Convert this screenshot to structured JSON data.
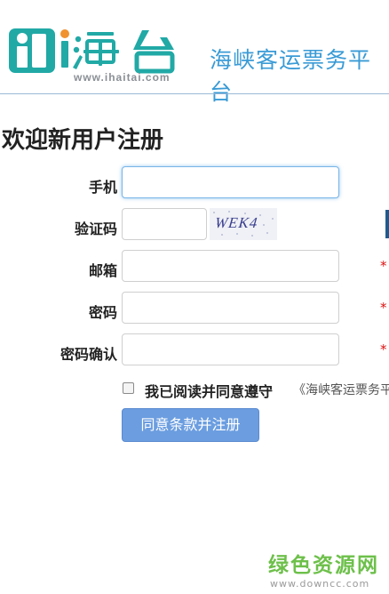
{
  "header": {
    "logo_text": "i海台",
    "logo_url": "www.ihaitai.com",
    "slogan": "海峡客运票务平台"
  },
  "page_title": "欢迎新用户注册",
  "form": {
    "phone": {
      "label": "手机",
      "value": "",
      "placeholder": ""
    },
    "verify": {
      "label": "验证码",
      "value": "",
      "placeholder": "",
      "captcha": "WEK4"
    },
    "email": {
      "label": "邮箱",
      "value": "",
      "placeholder": "",
      "required_mark": "*"
    },
    "password": {
      "label": "密码",
      "value": "",
      "placeholder": "",
      "required_mark": "*"
    },
    "password_confirm": {
      "label": "密码确认",
      "value": "",
      "placeholder": "",
      "required_mark": "*"
    },
    "agree": {
      "checked": false,
      "text": "我已阅读并同意遵守",
      "terms_link": "《海峡客运票务平"
    },
    "submit_label": "同意条款并注册"
  },
  "watermark": {
    "main": "绿色资源网",
    "url": "www.downcc.com"
  },
  "colors": {
    "logo_teal": "#21a9a6",
    "logo_orange": "#f0922e",
    "slogan_blue": "#3a9bd6",
    "button_blue": "#6b9de0",
    "required_red": "#dd1111",
    "watermark_green": "#6dc04a"
  }
}
